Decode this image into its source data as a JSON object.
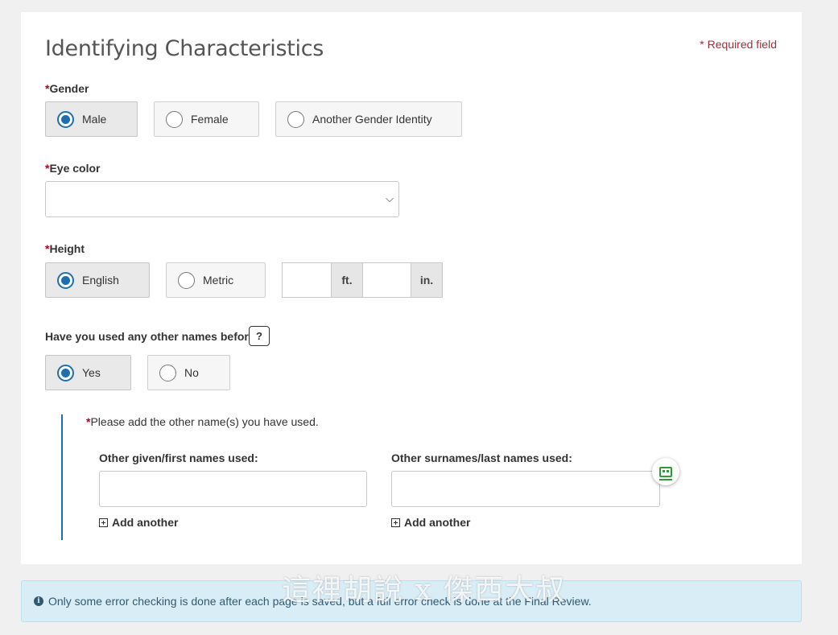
{
  "section": {
    "title": "Identifying Characteristics",
    "required_note": "* Required field"
  },
  "gender": {
    "label": "Gender",
    "required_mark": "*",
    "options": [
      "Male",
      "Female",
      "Another Gender Identity"
    ],
    "selected": "Male"
  },
  "eye_color": {
    "label": "Eye color",
    "required_mark": "*",
    "value": ""
  },
  "height": {
    "label": "Height",
    "required_mark": "*",
    "options": [
      "English",
      "Metric"
    ],
    "selected": "English",
    "feet_unit": "ft.",
    "inches_unit": "in.",
    "feet_value": "",
    "inches_value": ""
  },
  "other_names": {
    "question": "Have you used any other names before?",
    "help_label": "?",
    "options": [
      "Yes",
      "No"
    ],
    "selected": "Yes",
    "prompt_mark": "*",
    "prompt": "Please add the other name(s) you have used.",
    "given_label": "Other given/first names used:",
    "surname_label": "Other surnames/last names used:",
    "given_value": "",
    "surname_value": "",
    "add_another": "Add another"
  },
  "info_bar": {
    "icon": "info-icon",
    "text": "Only some error checking is done after each page is saved, but a full error check is done at the Final Review."
  },
  "watermark": "這裡胡說 x 傑西大叔",
  "colors": {
    "accent": "#1f6fad",
    "required": "#b00020",
    "info_bg": "#d9edf7"
  }
}
